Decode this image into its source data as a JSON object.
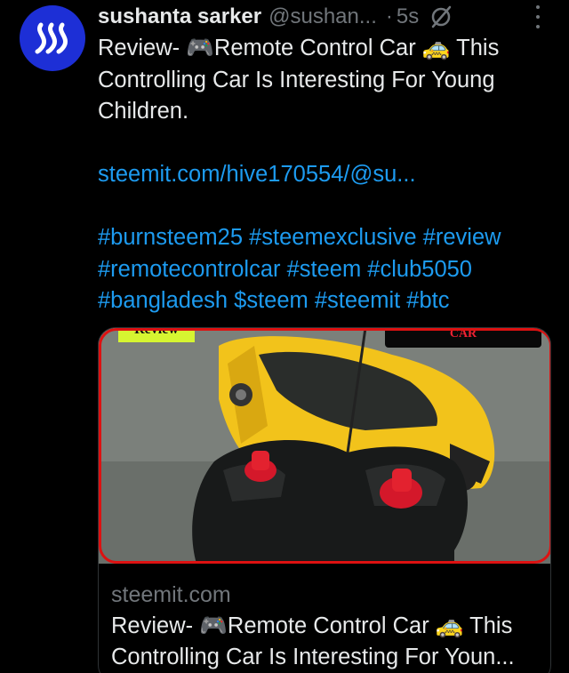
{
  "tweet": {
    "author_name": "sushanta sarker",
    "author_handle": "@sushan...",
    "separator": "·",
    "time": "5s",
    "text_line1": "Review- 🎮Remote Control Car 🚕 This",
    "text_line2": "Controlling Car Is Interesting For Young",
    "text_line3": "Children.",
    "link": "steemit.com/hive170554/@su...",
    "tags_line1": "#burnsteem25 #steemexclusive #review",
    "tags_line2": "#remotecontrolcar #steem #club5050",
    "tags_line3": "#bangladesh $steem #steemit #btc"
  },
  "card": {
    "image_label_left": "Review",
    "image_label_right": "CAR",
    "domain": "steemit.com",
    "title_line1": "Review- 🎮Remote Control Car 🚕 This",
    "title_line2": "Controlling Car Is Interesting For Youn..."
  },
  "colors": {
    "background": "#000000",
    "text": "#e7e9ea",
    "muted": "#71767b",
    "link": "#1d9bf0",
    "avatar": "#1d2fd6"
  },
  "icons": {
    "avatar": "steem-logo-icon",
    "grok": "grok-icon",
    "more": "more-vertical-icon"
  }
}
